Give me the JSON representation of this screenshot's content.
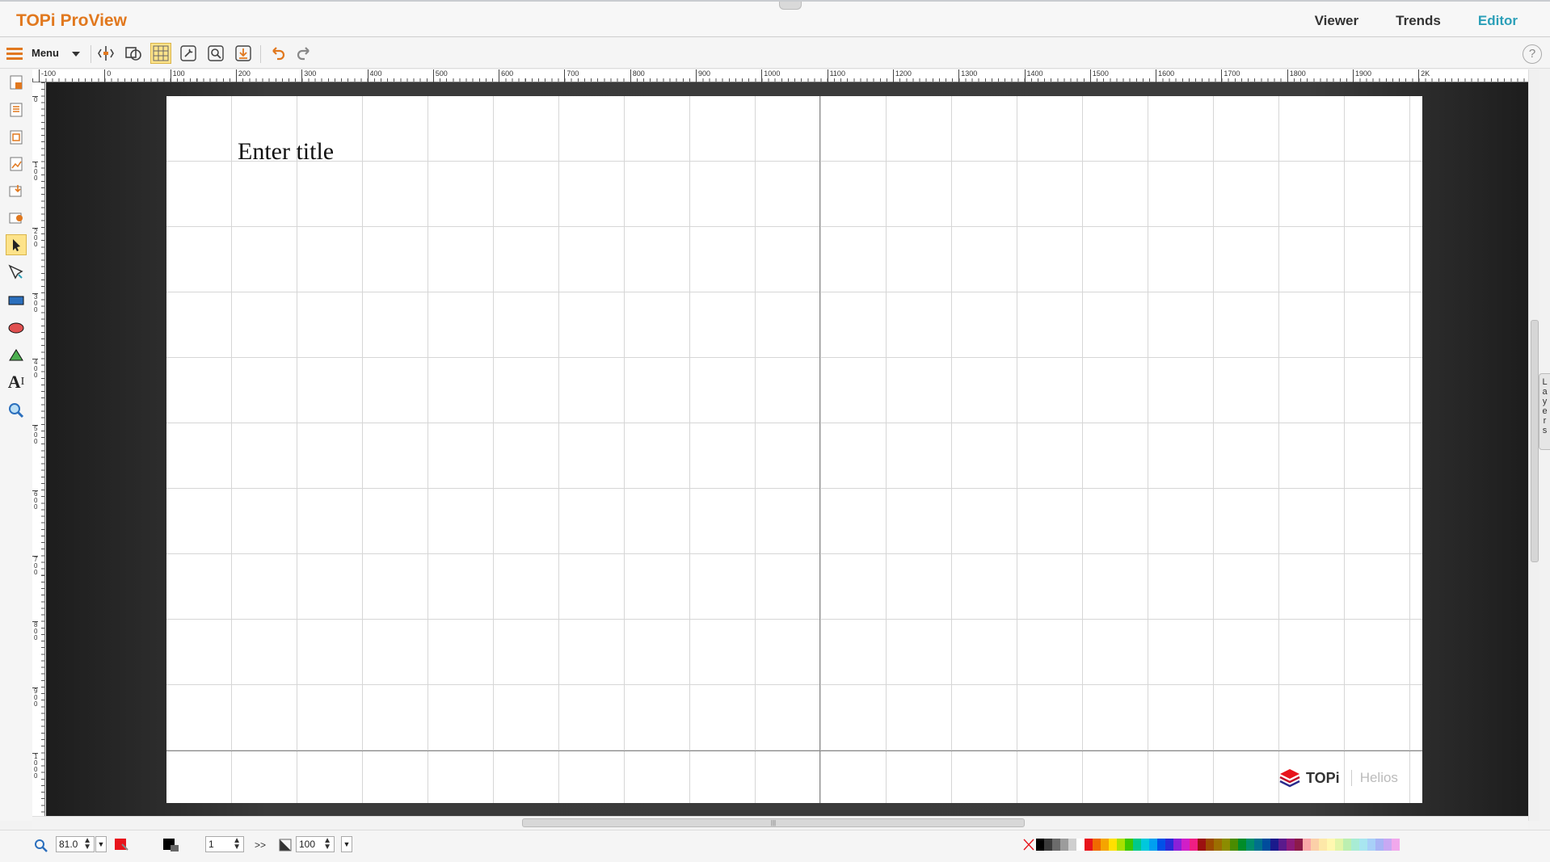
{
  "app": {
    "brand": "TOPi ProView"
  },
  "topnav": [
    {
      "label": "Viewer"
    },
    {
      "label": "Trends"
    },
    {
      "label": "Editor",
      "active": true
    }
  ],
  "toolbar": {
    "menu_label": "Menu",
    "help_label": "?"
  },
  "ruler": {
    "h_labels": [
      "-100",
      "0",
      "100",
      "200",
      "300",
      "400",
      "500",
      "600",
      "700",
      "800",
      "900",
      "1000",
      "1100",
      "1200",
      "1300",
      "1400",
      "1500",
      "1600",
      "1700",
      "1800",
      "1900",
      "2K"
    ],
    "v_labels": [
      "0",
      "100",
      "200",
      "300",
      "400",
      "500",
      "600",
      "700",
      "800",
      "900",
      "1000"
    ]
  },
  "canvas": {
    "title": "Enter title"
  },
  "logo": {
    "name": "TOPi",
    "sub": "Helios"
  },
  "layers_tab": {
    "label": "Layers"
  },
  "statusbar": {
    "zoom": "81.0",
    "page": "1",
    "next_label": ">>",
    "opacity": "100"
  },
  "colors": {
    "accent": "#e1781e",
    "active_tab": "#2b9fb8",
    "fill_color": "#e8141c",
    "stroke_color": "#000000",
    "palette": [
      "#000000",
      "#3a3a3a",
      "#6b6b6b",
      "#9c9c9c",
      "#cfcfcf",
      "#ffffff",
      "#e8141c",
      "#f06a00",
      "#f5a400",
      "#ffe000",
      "#a8e000",
      "#3cc700",
      "#00c98a",
      "#00c8dc",
      "#00a0f0",
      "#0050e8",
      "#2a2ad8",
      "#8a20d8",
      "#d01ec8",
      "#f01e82",
      "#9c1010",
      "#9c4a00",
      "#9c6e00",
      "#8c8c00",
      "#4a8c00",
      "#008c28",
      "#008c6a",
      "#00708c",
      "#004c9c",
      "#1a1a8c",
      "#5a1a8c",
      "#8c1a7a",
      "#8c1a4a",
      "#f9a8a8",
      "#fbd0a8",
      "#fde8a8",
      "#fff8b0",
      "#e2f5a8",
      "#bcefb0",
      "#a8ecd4",
      "#a8e6f0",
      "#a8d0f8",
      "#a8b4f5",
      "#c8a8f3",
      "#f1a8ec"
    ]
  }
}
